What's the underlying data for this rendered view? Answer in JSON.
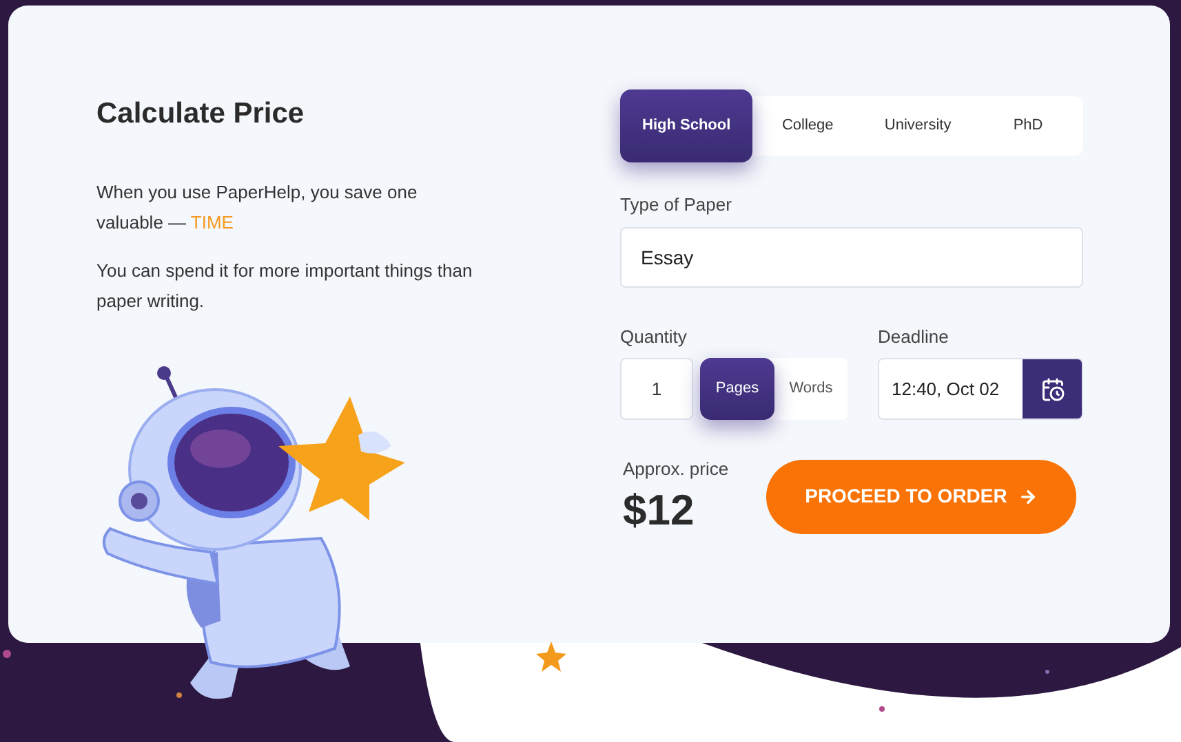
{
  "title": "Calculate Price",
  "intro": {
    "text": "When you use PaperHelp, you save one valuable — ",
    "highlight": "TIME"
  },
  "note": "You can spend it for more important things than paper writing.",
  "levels": [
    {
      "label": "High School",
      "selected": true
    },
    {
      "label": "College",
      "selected": false
    },
    {
      "label": "University",
      "selected": false
    },
    {
      "label": "PhD",
      "selected": false
    }
  ],
  "paper_type": {
    "label": "Type of Paper",
    "value": "Essay"
  },
  "quantity": {
    "label": "Quantity",
    "value": "1",
    "units": [
      {
        "label": "Pages",
        "selected": true
      },
      {
        "label": "Words",
        "selected": false
      }
    ]
  },
  "deadline": {
    "label": "Deadline",
    "value": "12:40, Oct 02"
  },
  "price": {
    "label": "Approx. price",
    "value": "$12"
  },
  "order_button": "PROCEED TO ORDER"
}
